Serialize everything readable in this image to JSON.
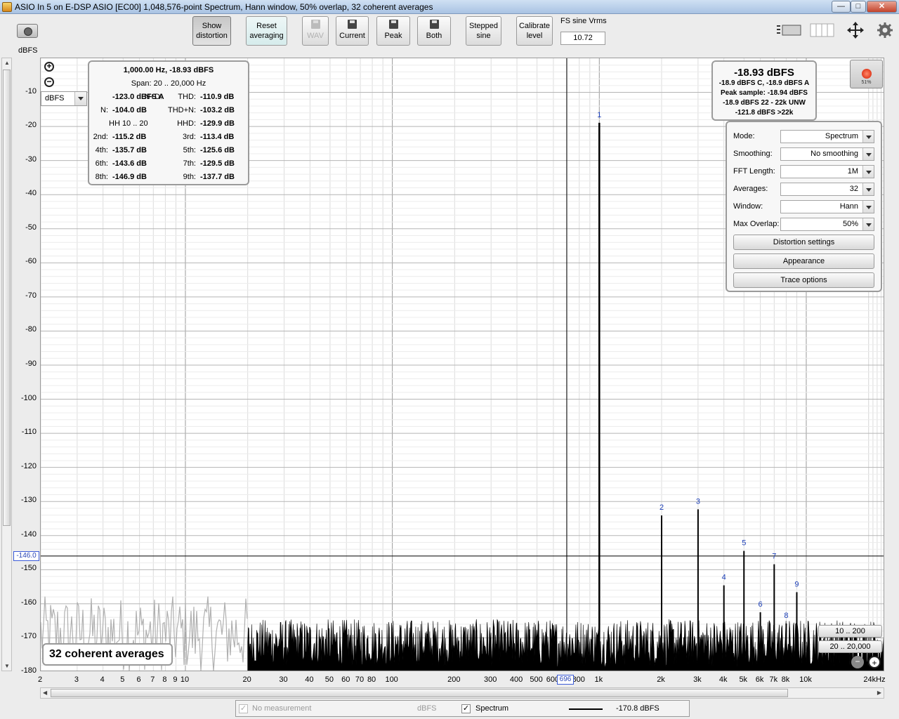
{
  "window": {
    "title": "ASIO In 5 on E-DSP ASIO [EC00] 1,048,576-point Spectrum, Hann window, 50% overlap, 32 coherent averages",
    "minimize": "—",
    "maximize": "□",
    "close": "✕"
  },
  "toolbar": {
    "show_distortion": [
      "Show",
      "distortion"
    ],
    "reset_averaging": [
      "Reset",
      "averaging"
    ],
    "wav": "WAV",
    "current": "Current",
    "peak": "Peak",
    "both": "Both",
    "stepped_sine": [
      "Stepped",
      "sine"
    ],
    "calibrate_level": [
      "Calibrate",
      "level"
    ],
    "fs_label": "FS sine Vrms",
    "fs_value": "10.72"
  },
  "units": {
    "y_unit": "dBFS",
    "unit_selector": "dBFS"
  },
  "distortion": {
    "header": "1,000.00 Hz, -18.93 dBFS",
    "span": "Span: 20 .. 20,000 Hz",
    "nd_label": "N+D:",
    "nd_value": "-123.0 dBFS A",
    "thd_label": "THD:",
    "thd_value": "-110.9 dB",
    "n_label": "N:",
    "n_value": "-104.0 dB",
    "thdn_label": "THD+N:",
    "thdn_value": "-103.2 dB",
    "hh_label": "HH 10 .. 20",
    "hhd_label": "HHD:",
    "hhd_value": "-129.9 dB",
    "h2_label": "2nd:",
    "h2_value": "-115.2 dB",
    "h3_label": "3rd:",
    "h3_value": "-113.4 dB",
    "h4_label": "4th:",
    "h4_value": "-135.7 dB",
    "h5_label": "5th:",
    "h5_value": "-125.6 dB",
    "h6_label": "6th:",
    "h6_value": "-143.6 dB",
    "h7_label": "7th:",
    "h7_value": "-129.5 dB",
    "h8_label": "8th:",
    "h8_value": "-146.9 dB",
    "h9_label": "9th:",
    "h9_value": "-137.7 dB"
  },
  "readout": {
    "main": "-18.93 dBFS",
    "line1": "-18.9 dBFS C, -18.9 dBFS A",
    "line2": "Peak sample: -18.94 dBFS",
    "line3": "-18.9 dBFS 22 - 22k UNW",
    "line4": "-121.8 dBFS >22k",
    "record_pct": "51%"
  },
  "settings": {
    "mode_label": "Mode:",
    "mode_value": "Spectrum",
    "smoothing_label": "Smoothing:",
    "smoothing_value": "No  smoothing",
    "fft_label": "FFT Length:",
    "fft_value": "1M",
    "averages_label": "Averages:",
    "averages_value": "32",
    "window_label": "Window:",
    "window_value": "Hann",
    "overlap_label": "Max Overlap:",
    "overlap_value": "50%",
    "distortion_settings": "Distortion settings",
    "appearance": "Appearance",
    "trace_options": "Trace options"
  },
  "plot": {
    "averages_badge": "32 coherent averages",
    "range_btn_1": "10 .. 200",
    "range_btn_2": "20 .. 20,000",
    "y_cursor": "-146.0",
    "x_cursor": "696",
    "zoom_in": "+",
    "zoom_out": "−"
  },
  "legend": {
    "no_measurement": "No measurement",
    "no_measurement_unit": "dBFS",
    "spectrum": "Spectrum",
    "spectrum_value": "-170.8 dBFS"
  },
  "chart_data": {
    "type": "line",
    "x_scale": "log",
    "y_unit": "dBFS",
    "x_unit": "Hz",
    "xlim": [
      2,
      24000
    ],
    "ylim": [
      -180,
      0
    ],
    "y_ticks": [
      -10,
      -20,
      -30,
      -40,
      -50,
      -60,
      -70,
      -80,
      -90,
      -100,
      -110,
      -120,
      -130,
      -140,
      -150,
      -160,
      -170,
      -180
    ],
    "x_ticks": [
      {
        "v": 2,
        "l": "2"
      },
      {
        "v": 3,
        "l": "3"
      },
      {
        "v": 4,
        "l": "4"
      },
      {
        "v": 5,
        "l": "5"
      },
      {
        "v": 6,
        "l": "6"
      },
      {
        "v": 7,
        "l": "7"
      },
      {
        "v": 8,
        "l": "8"
      },
      {
        "v": 9,
        "l": "9"
      },
      {
        "v": 10,
        "l": "10"
      },
      {
        "v": 20,
        "l": "20"
      },
      {
        "v": 30,
        "l": "30"
      },
      {
        "v": 40,
        "l": "40"
      },
      {
        "v": 50,
        "l": "50"
      },
      {
        "v": 60,
        "l": "60"
      },
      {
        "v": 70,
        "l": "70"
      },
      {
        "v": 80,
        "l": "80"
      },
      {
        "v": 100,
        "l": "100"
      },
      {
        "v": 200,
        "l": "200"
      },
      {
        "v": 300,
        "l": "300"
      },
      {
        "v": 400,
        "l": "400"
      },
      {
        "v": 500,
        "l": "500"
      },
      {
        "v": 600,
        "l": "600"
      },
      {
        "v": 800,
        "l": "800"
      },
      {
        "v": 1000,
        "l": "1k"
      },
      {
        "v": 2000,
        "l": "2k"
      },
      {
        "v": 3000,
        "l": "3k"
      },
      {
        "v": 4000,
        "l": "4k"
      },
      {
        "v": 5000,
        "l": "5k"
      },
      {
        "v": 6000,
        "l": "6k"
      },
      {
        "v": 7000,
        "l": "7k"
      },
      {
        "v": 8000,
        "l": "8k"
      },
      {
        "v": 10000,
        "l": "10k"
      },
      {
        "v": 24000,
        "l": "24kHz"
      }
    ],
    "harmonics": [
      {
        "n": "1",
        "f": 1000,
        "db": -18.93
      },
      {
        "n": "2",
        "f": 2000,
        "db": -134.1
      },
      {
        "n": "3",
        "f": 3000,
        "db": -132.3
      },
      {
        "n": "4",
        "f": 4000,
        "db": -154.6
      },
      {
        "n": "5",
        "f": 5000,
        "db": -144.5
      },
      {
        "n": "6",
        "f": 6000,
        "db": -162.5
      },
      {
        "n": "7",
        "f": 7000,
        "db": -148.4
      },
      {
        "n": "8",
        "f": 8000,
        "db": -165.8
      },
      {
        "n": "9",
        "f": 9000,
        "db": -156.6
      }
    ],
    "noise_floor_db": -170.8,
    "cursor_y_db": -146.0,
    "cursor_x_hz": 696
  }
}
